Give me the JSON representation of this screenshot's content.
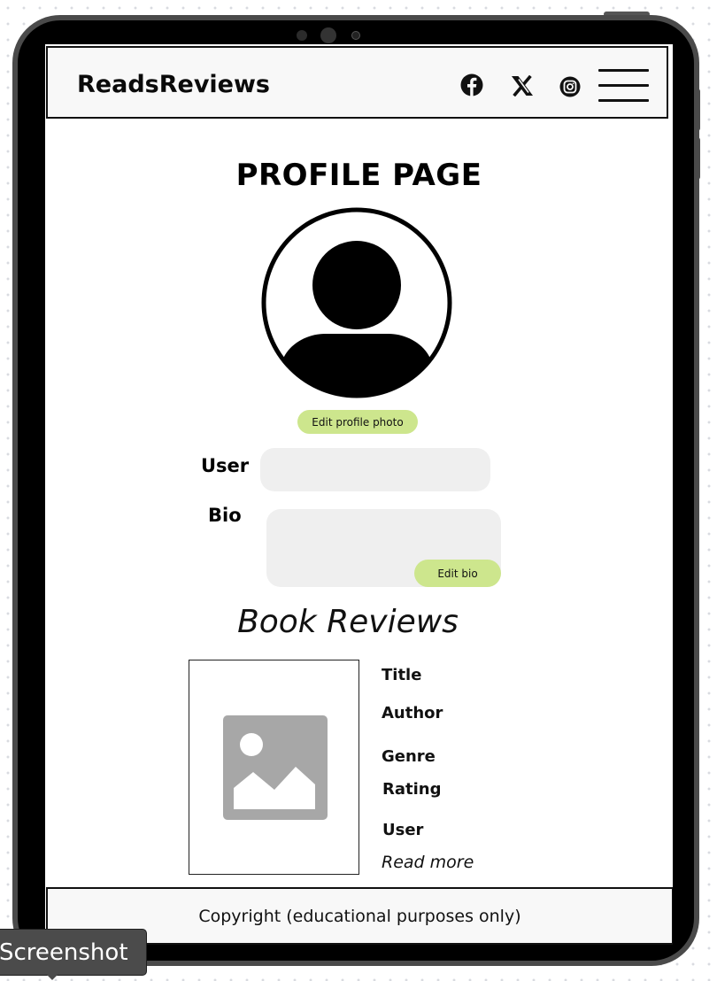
{
  "header": {
    "brand": "ReadsReviews",
    "social_icons": [
      "facebook-icon",
      "x-icon",
      "instagram-icon"
    ],
    "menu_icon": "hamburger-menu-icon"
  },
  "main": {
    "title": "PROFILE PAGE",
    "edit_photo_label": "Edit profile photo",
    "user_label": "User",
    "user_value": "",
    "bio_label": "Bio",
    "bio_value": "",
    "edit_bio_label": "Edit bio"
  },
  "reviews": {
    "title": "Book Reviews",
    "items": [
      {
        "image_icon": "image-placeholder-icon",
        "title_label": "Title",
        "author_label": "Author",
        "genre_label": "Genre",
        "rating_label": "Rating",
        "user_label": "User",
        "read_more": "Read more"
      }
    ]
  },
  "footer": {
    "text": "Copyright (educational purposes only)"
  },
  "overlay": {
    "tooltip": "Screenshot"
  },
  "colors": {
    "accent_button": "#cde68d",
    "input_bg": "#efefef",
    "device_frame": "#000000"
  }
}
